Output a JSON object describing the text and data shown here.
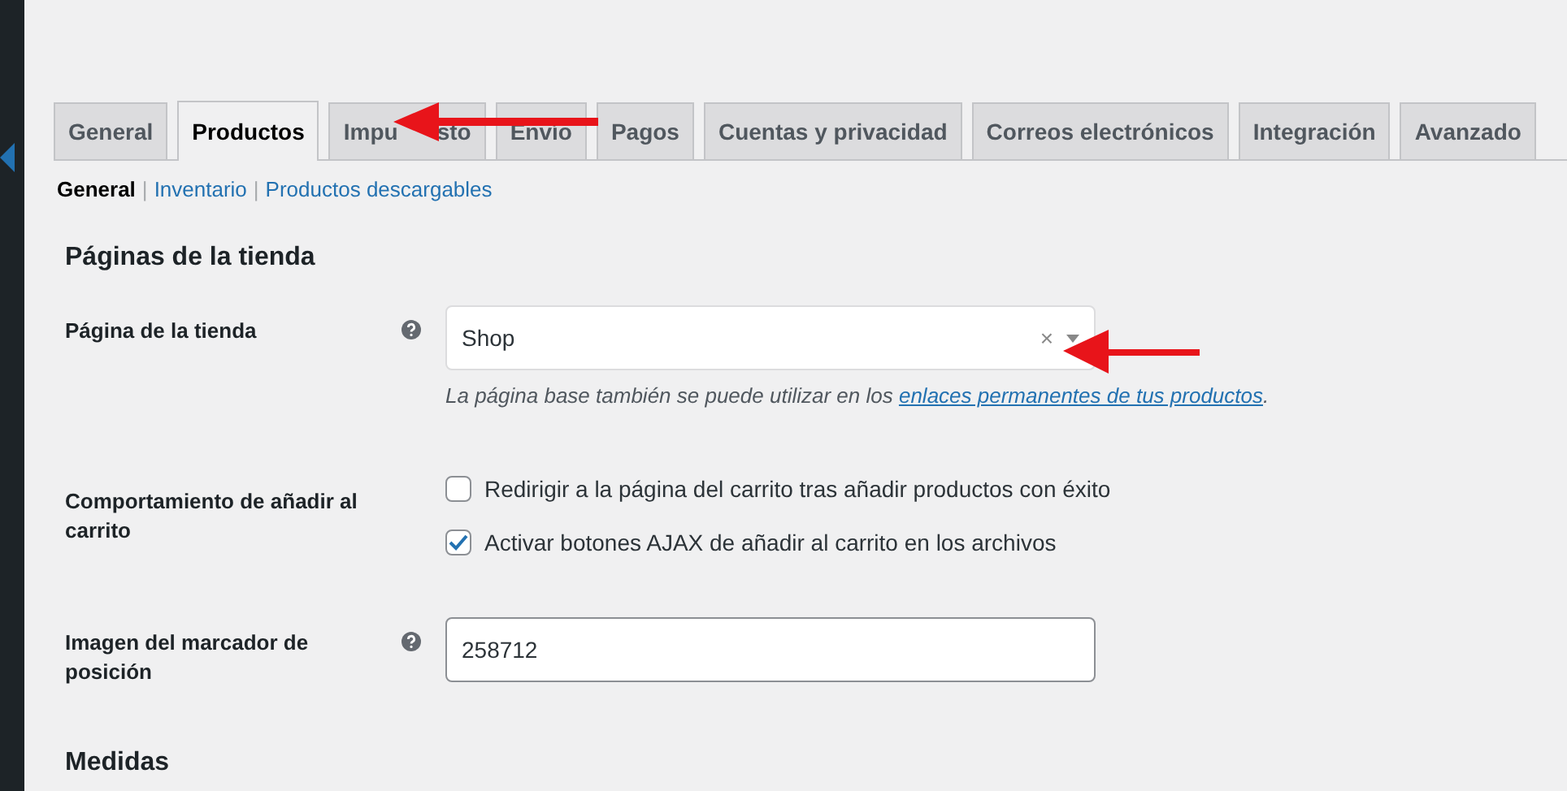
{
  "tabs": [
    {
      "label": "General",
      "selected": false
    },
    {
      "label": "Productos",
      "selected": true
    },
    {
      "label": "Impu",
      "label_tail": "sto",
      "selected": false
    },
    {
      "label": "Envío",
      "selected": false
    },
    {
      "label": "Pagos",
      "selected": false
    },
    {
      "label": "Cuentas y privacidad",
      "selected": false
    },
    {
      "label": "Correos electrónicos",
      "selected": false
    },
    {
      "label": "Integración",
      "selected": false
    },
    {
      "label": "Avanzado",
      "selected": false
    }
  ],
  "subnav": [
    {
      "label": "General",
      "selected": true
    },
    {
      "separator": "|",
      "label": "Inventario",
      "selected": false
    },
    {
      "separator": "|",
      "label": "Productos descargables",
      "selected": false
    }
  ],
  "section_title": "Páginas de la tienda",
  "rows": [
    {
      "kind": "select",
      "label": "Página de la tienda",
      "help": true,
      "value": "Shop",
      "clear": "×",
      "description": {
        "before": "La página base también se puede utilizar en los ",
        "link": "enlaces permanentes de tus productos",
        "after": "."
      }
    },
    {
      "kind": "checkboxes",
      "label": "Comportamiento de añadir al carrito",
      "help": false,
      "options": [
        {
          "label": "Redirigir a la página del carrito tras añadir productos con éxito",
          "checked": false
        },
        {
          "label": "Activar botones AJAX de añadir al carrito en los archivos",
          "checked": true
        }
      ]
    },
    {
      "kind": "text",
      "label": "Imagen del marcador de posición",
      "help": true,
      "value": "258712"
    }
  ],
  "next_section_title": "Medidas"
}
